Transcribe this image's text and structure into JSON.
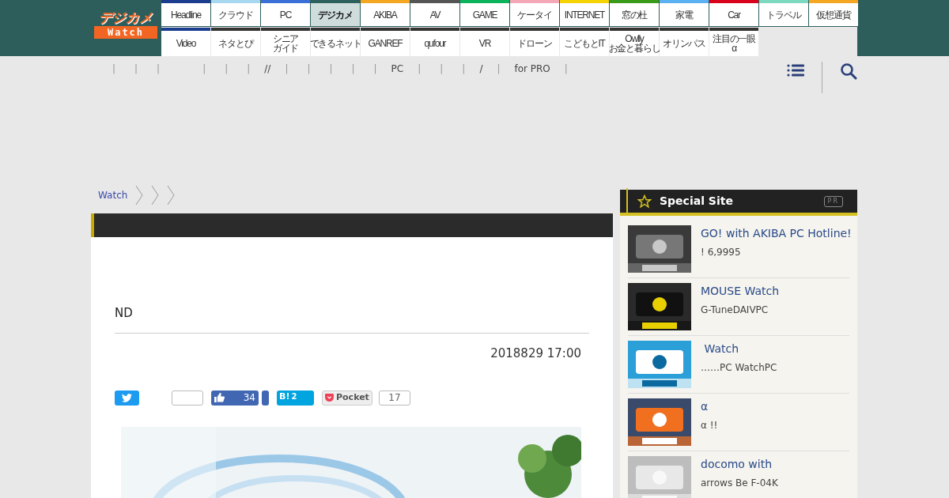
{
  "logo": {
    "top": "デジカメ",
    "bottom": "Watch"
  },
  "nav_rows": [
    [
      {
        "label": "Headline",
        "color": "#1a3d8f",
        "selected": false
      },
      {
        "label": "クラウド",
        "color": "#a8d8f0",
        "selected": false
      },
      {
        "label": "PC",
        "color": "#3a6fd8",
        "selected": false
      },
      {
        "label": "デジカメ",
        "color": "#2d5f5c",
        "selected": true
      },
      {
        "label": "AKIBA",
        "color": "#f5a623",
        "selected": false
      },
      {
        "label": "AV",
        "color": "#555555",
        "selected": false
      },
      {
        "label": "GAME",
        "color": "#0bb35a",
        "selected": false
      },
      {
        "label": "ケータイ",
        "color": "#f4a7b9",
        "selected": false
      },
      {
        "label": "INTERNET",
        "color": "#f5d300",
        "selected": false
      },
      {
        "label": "窓の杜",
        "color": "#3a9a1a",
        "selected": false
      },
      {
        "label": "家電",
        "color": "#5ab0f0",
        "selected": false
      },
      {
        "label": "Car",
        "color": "#d9001b",
        "selected": false
      },
      {
        "label": "トラベル",
        "color": "#7dd8c0",
        "selected": false
      },
      {
        "label": "仮想通貨",
        "color": "#f5a623",
        "selected": false
      }
    ],
    [
      {
        "label": "Video",
        "color": "#1a3d8f",
        "selected": false
      },
      {
        "label": "ネタとぴ",
        "color": "#333333",
        "selected": false
      },
      {
        "lines": [
          "シニア",
          "ガイド"
        ],
        "color": "#333333",
        "selected": false
      },
      {
        "label": "できるネット",
        "color": "#333333",
        "selected": false
      },
      {
        "label": "GANREF",
        "color": "#333333",
        "selected": false
      },
      {
        "label": "qufour",
        "color": "#333333",
        "selected": false
      },
      {
        "label": "VR",
        "color": "#333333",
        "selected": false
      },
      {
        "label": "ドローン",
        "color": "#333333",
        "selected": false
      },
      {
        "label": "こどもとIT",
        "color": "#333333",
        "selected": false
      },
      {
        "lines": [
          "Owlly",
          "お金と暮らし"
        ],
        "color": "#333333",
        "selected": false
      },
      {
        "label": "オリンパス",
        "color": "#333333",
        "selected": false
      },
      {
        "lines": [
          "注目の一眼",
          "α"
        ],
        "color": "#333333",
        "selected": false
      }
    ]
  ],
  "sub_nav": [
    "|",
    "|",
    "|",
    "|",
    "|",
    "|",
    "//",
    "|",
    "|",
    "|",
    "|",
    "|",
    "PC",
    "|",
    "|",
    "|",
    "/",
    "|",
    "for PRO",
    "|"
  ],
  "breadcrumb": [
    "Watch"
  ],
  "article": {
    "title": "ND",
    "date": "2018829 17:00",
    "share": [
      {
        "kind": "twitter"
      },
      {
        "kind": "count"
      },
      {
        "kind": "like",
        "text": "34"
      },
      {
        "kind": "share"
      },
      {
        "kind": "hatena",
        "text": "B!",
        "count": "2"
      },
      {
        "kind": "pocket",
        "text": "Pocket"
      },
      {
        "kind": "count",
        "text": "17"
      }
    ]
  },
  "sidebar": {
    "title": "Special Site",
    "badge": "PR",
    "items": [
      {
        "title": "GO! with AKIBA PC Hotline!",
        "text": "! 6,9995"
      },
      {
        "title": "MOUSE Watch",
        "text": "G-TuneDAIVPC"
      },
      {
        "title": " Watch",
        "text": "……PC WatchPC"
      },
      {
        "title": "α",
        "text": "α !!"
      },
      {
        "title": "docomo with",
        "text": "arrows Be F-04K"
      }
    ]
  }
}
